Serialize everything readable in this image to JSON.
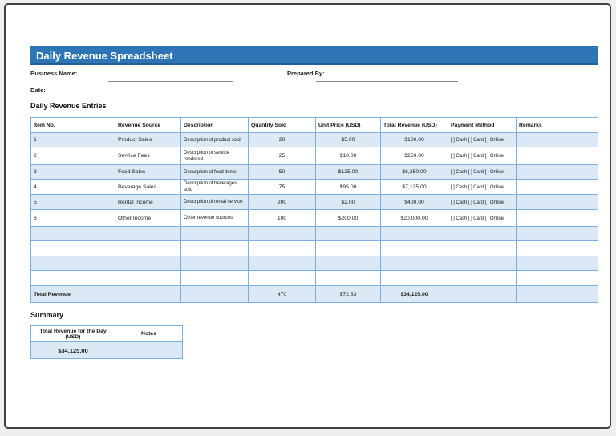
{
  "header": {
    "title": "Daily Revenue Spreadsheet"
  },
  "form": {
    "business_name_label": "Business Name:",
    "business_name_value": "",
    "prepared_by_label": "Prepared By:",
    "prepared_by_value": "",
    "date_label": "Date:",
    "date_value": ""
  },
  "entries": {
    "heading": "Daily Revenue Entries",
    "columns": [
      "Item No.",
      "Revenue Source",
      "Description",
      "Quantity Sold",
      "Unit Price (USD)",
      "Total Revenue (USD)",
      "Payment Method",
      "Remarks"
    ],
    "rows": [
      {
        "item_no": "1",
        "revenue_source": "Product Sales",
        "description": "Description of product sold",
        "quantity_sold": "20",
        "unit_price": "$5.00",
        "total_revenue": "$100.00",
        "payment_method": "[ ] Cash [ ] Card [ ] Online",
        "remarks": ""
      },
      {
        "item_no": "2",
        "revenue_source": "Service Fees",
        "description": "Description of service rendered",
        "quantity_sold": "25",
        "unit_price": "$10.00",
        "total_revenue": "$250.00",
        "payment_method": "[ ] Cash [ ] Card [ ] Online",
        "remarks": ""
      },
      {
        "item_no": "3",
        "revenue_source": "Food Sales",
        "description": "Description of food items",
        "quantity_sold": "50",
        "unit_price": "$125.00",
        "total_revenue": "$6,250.00",
        "payment_method": "[ ] Cash [ ] Card [ ] Online",
        "remarks": ""
      },
      {
        "item_no": "4",
        "revenue_source": "Beverage Sales",
        "description": "Description of beverages sold",
        "quantity_sold": "75",
        "unit_price": "$95.00",
        "total_revenue": "$7,125.00",
        "payment_method": "[ ] Cash [ ] Card [ ] Online",
        "remarks": ""
      },
      {
        "item_no": "5",
        "revenue_source": "Rental Income",
        "description": "Description of rental service",
        "quantity_sold": "200",
        "unit_price": "$2.00",
        "total_revenue": "$400.00",
        "payment_method": "[ ] Cash [ ] Card [ ] Online",
        "remarks": ""
      },
      {
        "item_no": "6",
        "revenue_source": "Other Income",
        "description": "Other revenue sources",
        "quantity_sold": "100",
        "unit_price": "$200.00",
        "total_revenue": "$20,000.00",
        "payment_method": "[ ] Cash [ ] Card [ ] Online",
        "remarks": ""
      }
    ],
    "empty_row_count": 4,
    "total_row": {
      "label": "Total Revenue",
      "quantity_sold": "470",
      "unit_price": "$72.83",
      "total_revenue": "$34,125.00"
    }
  },
  "summary": {
    "heading": "Summary",
    "columns": [
      "Total Revenue for the Day (USD)",
      "Notes"
    ],
    "total_value": "$34,125.00",
    "notes_value": ""
  },
  "colors": {
    "title_bar": "#2e75b6",
    "table_border": "#7eaedc",
    "banded_row": "#dbe8f6",
    "page_border": "#3e4043"
  }
}
